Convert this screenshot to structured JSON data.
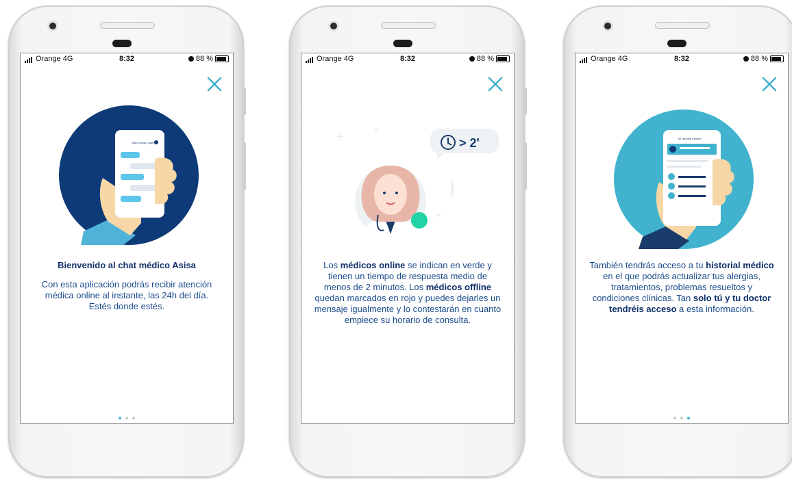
{
  "status_bar": {
    "carrier": "Orange  4G",
    "time": "8:32",
    "battery": "88 %"
  },
  "icons": {
    "close": "close-icon",
    "signal": "signal-icon",
    "alarm": "alarm-icon",
    "battery": "battery-icon"
  },
  "colors": {
    "text_primary": "#1b4b8c",
    "title": "#15326b",
    "close": "#3dafcf",
    "dot_active": "#48b5d6",
    "dot_inactive": "#c8c8c8",
    "circle_dark": "#0e3a78",
    "circle_teal": "#41b3cf",
    "online_green": "#22d3a6"
  },
  "slides": [
    {
      "title": "Bienvenido al chat médico Asisa",
      "body": "Con esta aplicación podrás recibir atención médica online al instante, las 24h del día. Estés donde estés.",
      "active_dot": 0
    },
    {
      "bubble": "> 2'",
      "parts": [
        "Los ",
        "médicos online",
        " se indican en verde y tienen un tiempo de respuesta medio de menos de 2 minutos. Los ",
        "médicos offline",
        " quedan marcados en rojo y puedes dejarles un mensaje igualmente y lo contestarán en cuanto empiece su horario de consulta."
      ],
      "active_dot": 1
    },
    {
      "card_title": "Mi historial médico",
      "parts": [
        "También tendrás acceso a tu ",
        "historial médico",
        " en el que podrás actualizar tus alergias, tratamientos, problemas resueltos y condiciones clínicas. Tan ",
        "solo tú y tu doctor tendréis acceso",
        " a esta información."
      ],
      "active_dot": 2
    }
  ],
  "chat_mock": {
    "header": "Dame Asisti Lopez"
  }
}
